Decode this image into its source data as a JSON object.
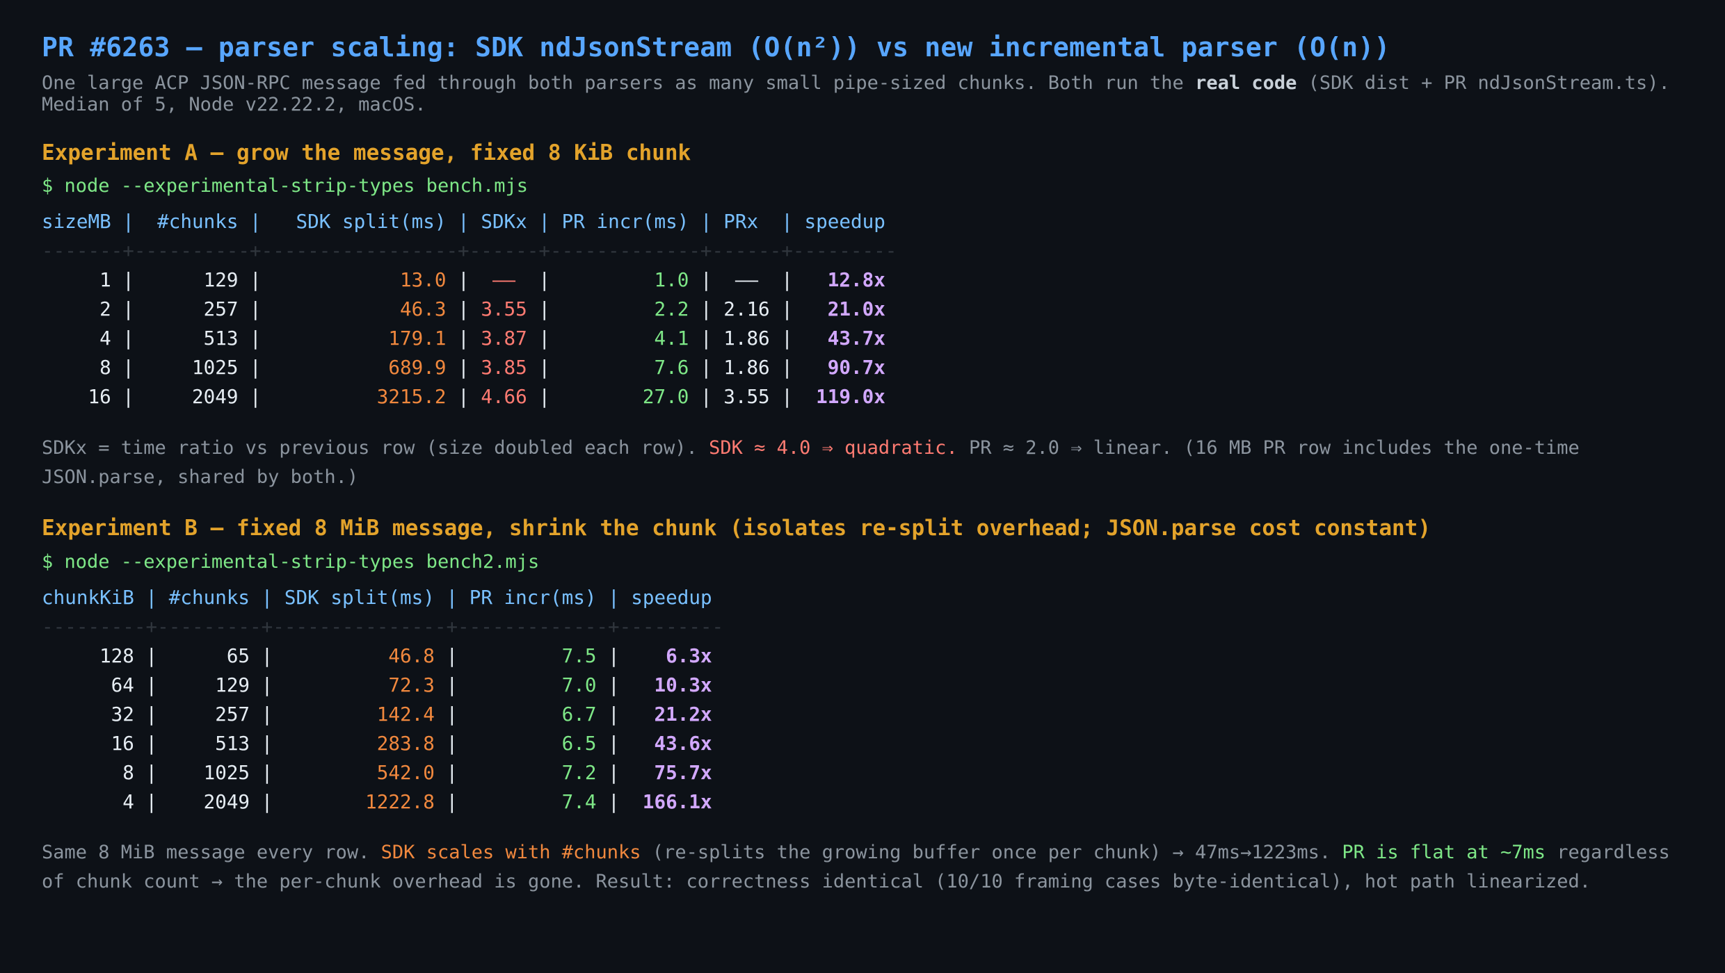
{
  "header": {
    "title": "PR #6263 — parser scaling: SDK ndJsonStream (O(n²)) vs new incremental parser (O(n))",
    "subtitle_a": "One large ACP JSON-RPC message fed through both parsers as many small pipe-sized chunks. Both run the ",
    "subtitle_bold": "real code",
    "subtitle_b": " (SDK dist + PR ndJsonStream.ts). Median of 5, Node v22.22.2, macOS."
  },
  "experiment_a": {
    "title": "Experiment A — grow the message, fixed 8 KiB chunk",
    "command": "$ node --experimental-strip-types bench.mjs",
    "columns": [
      "sizeMB",
      "#chunks",
      "SDK split(ms)",
      "SDKx",
      "PR incr(ms)",
      "PRx",
      "speedup"
    ],
    "rows": [
      {
        "sizeMB": "1",
        "chunks": "129",
        "sdk": "13.0",
        "sdkx": "—",
        "pr": "1.0",
        "prx": "—",
        "speedup": "12.8x"
      },
      {
        "sizeMB": "2",
        "chunks": "257",
        "sdk": "46.3",
        "sdkx": "3.55",
        "pr": "2.2",
        "prx": "2.16",
        "speedup": "21.0x"
      },
      {
        "sizeMB": "4",
        "chunks": "513",
        "sdk": "179.1",
        "sdkx": "3.87",
        "pr": "4.1",
        "prx": "1.86",
        "speedup": "43.7x"
      },
      {
        "sizeMB": "8",
        "chunks": "1025",
        "sdk": "689.9",
        "sdkx": "3.85",
        "pr": "7.6",
        "prx": "1.86",
        "speedup": "90.7x"
      },
      {
        "sizeMB": "16",
        "chunks": "2049",
        "sdk": "3215.2",
        "sdkx": "4.66",
        "pr": "27.0",
        "prx": "3.55",
        "speedup": "119.0x"
      }
    ],
    "note_a": "SDKx = time ratio vs previous row (size doubled each row). ",
    "note_red": "SDK ≈ 4.0 ⇒ quadratic.",
    "note_b": " PR ≈ 2.0 ⇒ linear. (16 MB PR row includes the one-time JSON.parse, shared by both.)"
  },
  "experiment_b": {
    "title": "Experiment B — fixed 8 MiB message, shrink the chunk (isolates re-split overhead; JSON.parse cost constant)",
    "command": "$ node --experimental-strip-types bench2.mjs",
    "columns": [
      "chunkKiB",
      "#chunks",
      "SDK split(ms)",
      "PR incr(ms)",
      "speedup"
    ],
    "rows": [
      {
        "chunkKiB": "128",
        "chunks": "65",
        "sdk": "46.8",
        "pr": "7.5",
        "speedup": "6.3x"
      },
      {
        "chunkKiB": "64",
        "chunks": "129",
        "sdk": "72.3",
        "pr": "7.0",
        "speedup": "10.3x"
      },
      {
        "chunkKiB": "32",
        "chunks": "257",
        "sdk": "142.4",
        "pr": "6.7",
        "speedup": "21.2x"
      },
      {
        "chunkKiB": "16",
        "chunks": "513",
        "sdk": "283.8",
        "pr": "6.5",
        "speedup": "43.6x"
      },
      {
        "chunkKiB": "8",
        "chunks": "1025",
        "sdk": "542.0",
        "pr": "7.2",
        "speedup": "75.7x"
      },
      {
        "chunkKiB": "4",
        "chunks": "2049",
        "sdk": "1222.8",
        "pr": "7.4",
        "speedup": "166.1x"
      }
    ],
    "note_a": "Same 8 MiB message every row. ",
    "note_orange": "SDK scales with #chunks",
    "note_b": " (re-splits the growing buffer once per chunk) → 47ms→1223ms. ",
    "note_green": "PR is flat at ~7ms",
    "note_c": " regardless of chunk count → the per-chunk overhead is gone. Result: correctness identical (10/10 framing cases byte-identical), hot path linearized."
  },
  "colors": {
    "background": "#0d1117",
    "title": "#58a6ff",
    "section": "#e3a32b",
    "command": "#7ee787",
    "header": "#79c0ff",
    "sdk_value": "#f0883e",
    "ratio_red": "#ff7b72",
    "pr_value": "#7ee787",
    "speedup": "#d2a8ff"
  }
}
